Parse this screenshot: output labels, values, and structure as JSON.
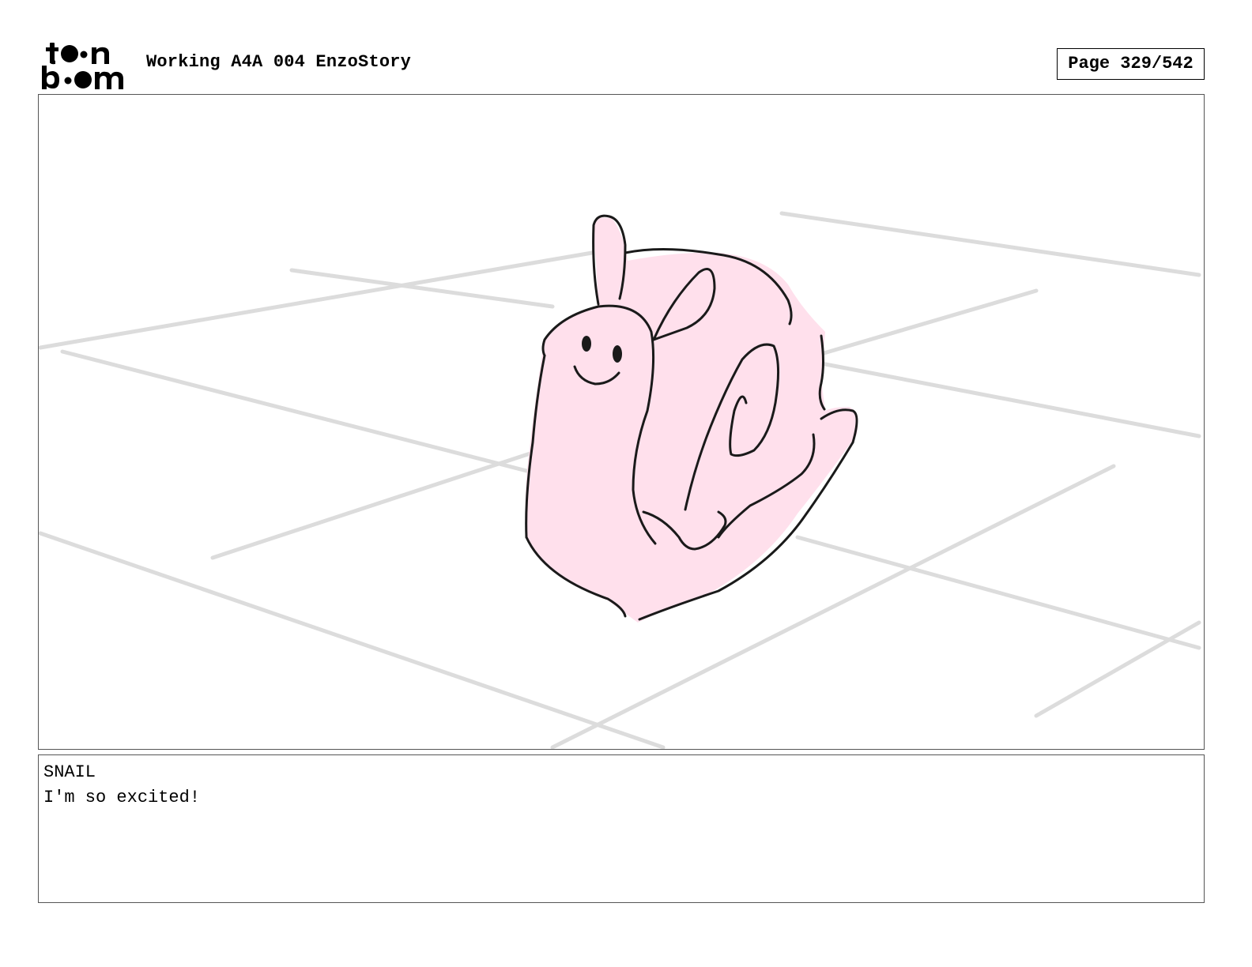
{
  "header": {
    "logo_text": "toon boom",
    "title": "Working A4A 004 EnzoStory",
    "page": "Page 329/542"
  },
  "panel": {
    "subject": "snail-drawing",
    "colors": {
      "snail_fill": "#ffe0ec",
      "outline": "#1a1a1a",
      "floor_grid": "#d8d8d8"
    }
  },
  "dialogue": {
    "character": "SNAIL",
    "line": "I'm so excited!"
  }
}
